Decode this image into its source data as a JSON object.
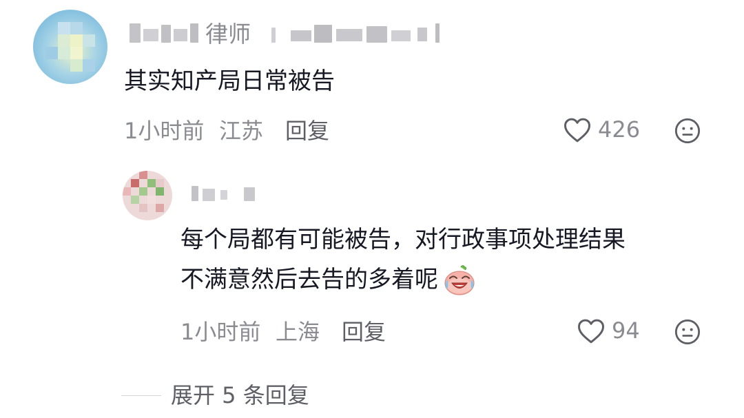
{
  "comments": [
    {
      "username_suffix": "律师",
      "text": "其实知产局日常被告",
      "time": "1小时前",
      "location": "江苏",
      "reply_label": "回复",
      "likes": "426"
    }
  ],
  "reply": {
    "text_line1": "每个局都有可能被告，对行政事项处理结果",
    "text_line2": "不满意然后去告的多着呢",
    "time": "1小时前",
    "location": "上海",
    "reply_label": "回复",
    "likes": "94"
  },
  "expand": {
    "label": "展开 5 条回复"
  },
  "icons": {
    "like": "heart-outline-icon",
    "dislike": "neutral-face-icon",
    "emoji": "crying-laughing-emoji-icon"
  },
  "colors": {
    "text_primary": "#161823",
    "text_secondary": "#8a8b91",
    "text_action": "#5e5f66"
  }
}
